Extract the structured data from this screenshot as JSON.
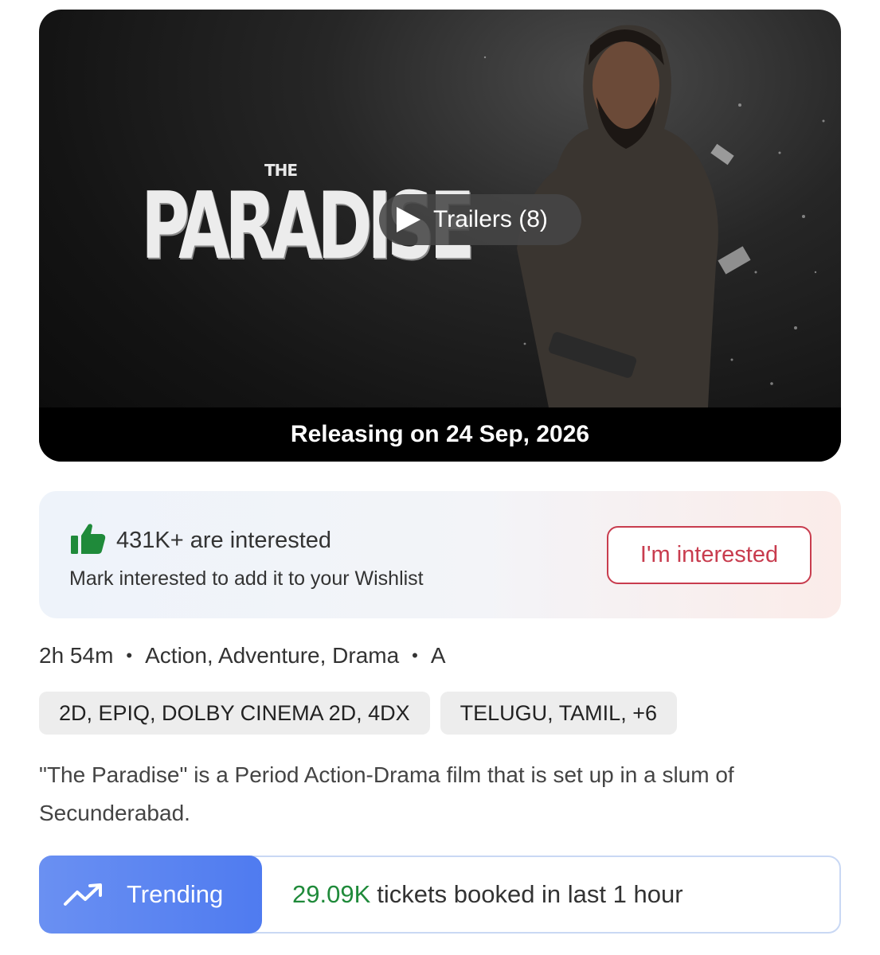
{
  "banner": {
    "poster_small_text": "THE",
    "poster_title": "PARADISE",
    "trailer_label": "Trailers (8)",
    "release_text": "Releasing on 24 Sep, 2026"
  },
  "interest": {
    "count_text": "431K+ are interested",
    "hint_text": "Mark interested to add it to your Wishlist",
    "button_label": "I'm interested",
    "icon": "thumbs-up-icon",
    "accent_color": "#1f8a3a",
    "button_color": "#c83c4e"
  },
  "meta": {
    "duration": "2h 54m",
    "genres": "Action, Adventure, Drama",
    "rating": "A",
    "separator": "•"
  },
  "tags": {
    "formats": "2D, EPIQ, DOLBY CINEMA 2D, 4DX",
    "languages": "TELUGU, TAMIL,  +6"
  },
  "description": "\"The Paradise\" is a Period Action-Drama film that is set up in a slum of Secunderabad.",
  "trending": {
    "label": "Trending",
    "count": "29.09K",
    "text": "tickets booked in last 1 hour",
    "icon": "trending-up-icon",
    "pill_color": "#5b85f1"
  }
}
